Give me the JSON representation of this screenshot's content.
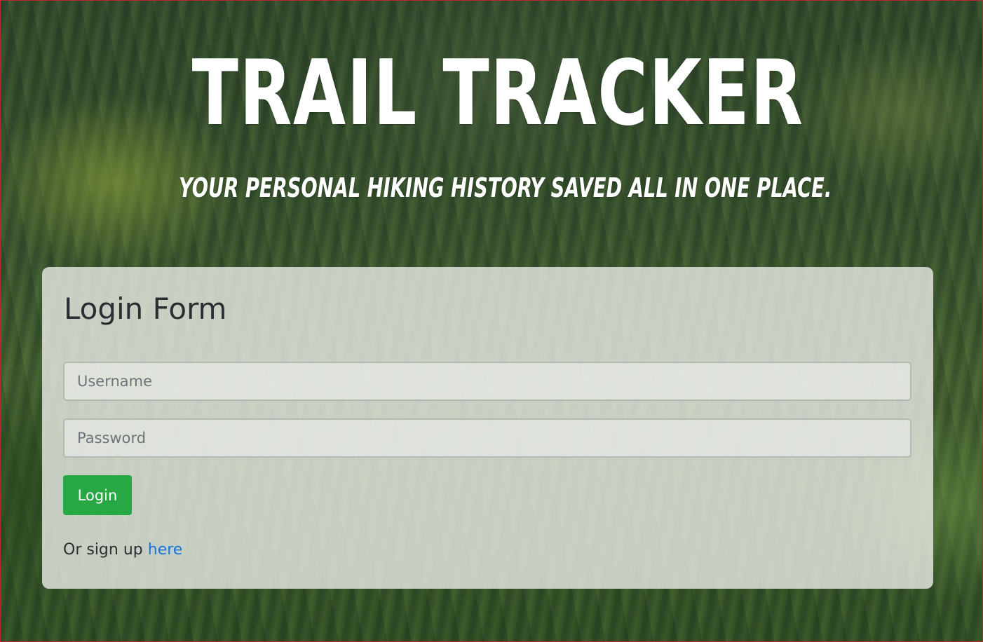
{
  "header": {
    "title": "TRAIL TRACKER",
    "subtitle": "YOUR PERSONAL HIKING HISTORY SAVED ALL IN ONE PLACE."
  },
  "login_form": {
    "title": "Login Form",
    "username_placeholder": "Username",
    "password_placeholder": "Password",
    "submit_label": "Login",
    "signup_prefix": "Or sign up",
    "signup_link_label": "here"
  },
  "colors": {
    "button": "#28a745",
    "link": "#1a73d9",
    "title_text": "#ffffff"
  }
}
